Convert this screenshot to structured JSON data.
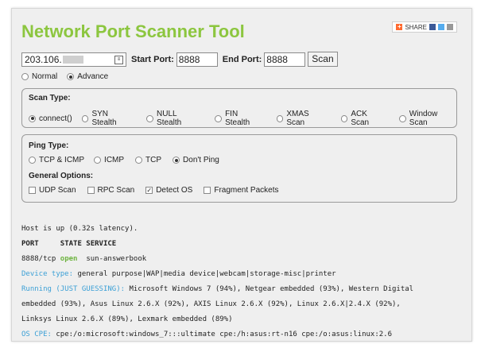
{
  "app_title": "Network Port Scanner Tool",
  "share": {
    "label": "SHARE"
  },
  "form": {
    "ip_value": "203.106.",
    "start_port_label": "Start Port:",
    "start_port_value": "8888",
    "end_port_label": "End Port:",
    "end_port_value": "8888",
    "scan_button": "Scan"
  },
  "mode": {
    "normal": "Normal",
    "advance": "Advance",
    "selected": "Advance"
  },
  "scan_type": {
    "header": "Scan Type:",
    "options": [
      "connect()",
      "SYN Stealth",
      "NULL Stealth",
      "FIN Stealth",
      "XMAS Scan",
      "ACK Scan",
      "Window Scan"
    ],
    "selected": "connect()"
  },
  "ping_type": {
    "header": "Ping Type:",
    "options": [
      "TCP & ICMP",
      "ICMP",
      "TCP",
      "Don't Ping"
    ],
    "selected": "Don't Ping"
  },
  "general_options": {
    "header": "General Options:",
    "options": [
      "UDP Scan",
      "RPC Scan",
      "Detect OS",
      "Fragment Packets"
    ],
    "checked": [
      "Detect OS"
    ]
  },
  "output": {
    "host_line": "Host is up (0.32s latency).",
    "col_port": "PORT",
    "col_state_service": "STATE SERVICE",
    "port_value": "8888/tcp",
    "state_value": "open",
    "service_value": "sun-answerbook",
    "device_type_label": "Device type:",
    "device_type_value": "general purpose|WAP|media device|webcam|storage-misc|printer",
    "running_label": "Running (JUST GUESSING):",
    "running_value_1": "Microsoft Windows 7 (94%), Netgear embedded (93%), Western Digital",
    "running_value_2": "embedded (93%), Asus Linux 2.6.X (92%), AXIS Linux 2.6.X (92%), Linux 2.6.X|2.4.X (92%),",
    "running_value_3": "Linksys Linux 2.6.X (89%), Lexmark embedded (89%)",
    "os_cpe_label": "OS CPE:",
    "os_cpe_value": "cpe:/o:microsoft:windows_7:::ultimate cpe:/h:asus:rt-n16 cpe:/o:asus:linux:2.6"
  },
  "colors": {
    "title": "#8cc63f",
    "label_blue": "#3ca0d6",
    "open_green": "#6db33f"
  }
}
